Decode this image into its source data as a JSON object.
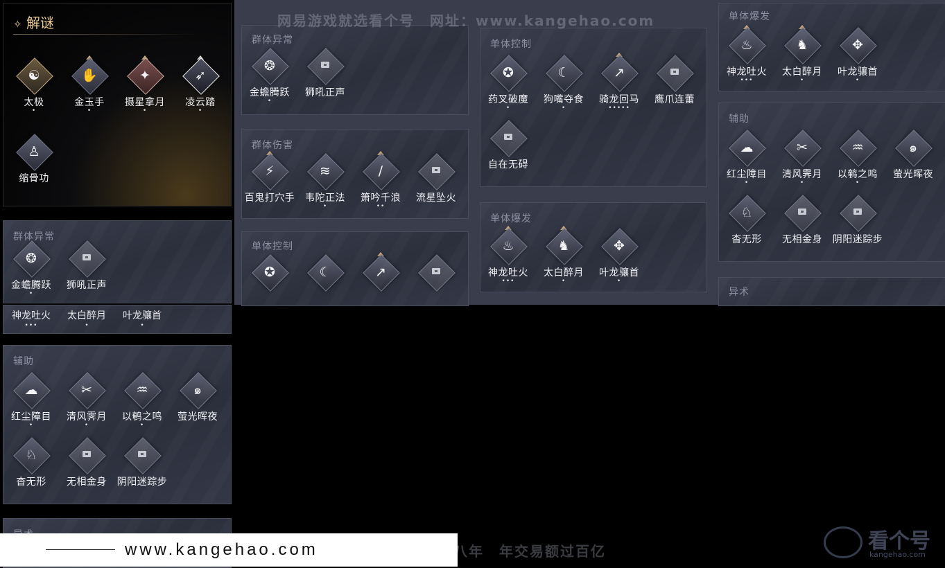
{
  "watermarks": {
    "top": "网易游戏就选看个号　网址：www.kangehao.com",
    "bottom": "看个号专业网易游戏八年　年交易额过百亿",
    "brand": "看个号",
    "brand_url": "kangehao.com",
    "footer_url": "www.kangehao.com"
  },
  "puzzle": {
    "star": "✧",
    "title": "解谜",
    "skills": [
      {
        "name": "太极",
        "dots": "•"
      },
      {
        "name": "金玉手",
        "dots": "•"
      },
      {
        "name": "摄星拿月",
        "dots": "•"
      },
      {
        "name": "凌云踏",
        "dots": "•"
      },
      {
        "name": "缩骨功",
        "dots": ""
      }
    ]
  },
  "left_col": {
    "group_abnormal": {
      "title": "群体异常",
      "skills": [
        {
          "name": "金蟾腾跃",
          "dots": "•"
        },
        {
          "name": "狮吼正声",
          "dots": ""
        }
      ]
    },
    "burst_partial": {
      "skills": [
        {
          "name": "神龙吐火",
          "dots": "•••"
        },
        {
          "name": "太白醉月",
          "dots": "•"
        },
        {
          "name": "叶龙骧首",
          "dots": "•"
        }
      ]
    },
    "support": {
      "title": "辅助",
      "skills": [
        {
          "name": "红尘障目",
          "dots": "•"
        },
        {
          "name": "清风霁月",
          "dots": "•"
        },
        {
          "name": "以鹌之鸣",
          "dots": "•"
        },
        {
          "name": "萤光晖夜",
          "dots": ""
        },
        {
          "name": "杳无形",
          "dots": ""
        },
        {
          "name": "无相金身",
          "dots": ""
        },
        {
          "name": "阴阳迷踪步",
          "dots": ""
        }
      ]
    },
    "bottom_partial_title": "异术"
  },
  "col2": {
    "group_abnormal": {
      "title": "群体异常",
      "skills": [
        {
          "name": "金蟾腾跃",
          "dots": "•"
        },
        {
          "name": "狮吼正声",
          "dots": ""
        }
      ]
    },
    "group_damage": {
      "title": "群体伤害",
      "skills": [
        {
          "name": "百鬼打穴手",
          "dots": ""
        },
        {
          "name": "韦陀正法",
          "dots": "•"
        },
        {
          "name": "箫吟千浪",
          "dots": "••"
        },
        {
          "name": "流星坠火",
          "dots": ""
        }
      ]
    },
    "single_control": {
      "title": "单体控制"
    }
  },
  "col3": {
    "single_control": {
      "title": "单体控制",
      "skills": [
        {
          "name": "药叉破魔",
          "dots": "•"
        },
        {
          "name": "狗嘴夺食",
          "dots": "•"
        },
        {
          "name": "骑龙回马",
          "dots": "•••••"
        },
        {
          "name": "鹰爪连蕾",
          "dots": ""
        },
        {
          "name": "自在无碍",
          "dots": ""
        }
      ]
    },
    "single_burst": {
      "title": "单体爆发",
      "skills": [
        {
          "name": "神龙吐火",
          "dots": "•••"
        },
        {
          "name": "太白醉月",
          "dots": "•"
        },
        {
          "name": "叶龙骧首",
          "dots": "•"
        }
      ]
    }
  },
  "col4": {
    "single_burst": {
      "title": "单体爆发",
      "skills": [
        {
          "name": "神龙吐火",
          "dots": "•••"
        },
        {
          "name": "太白醉月",
          "dots": "•"
        },
        {
          "name": "叶龙骧首",
          "dots": "•"
        }
      ]
    },
    "support": {
      "title": "辅助",
      "skills": [
        {
          "name": "红尘障目",
          "dots": "•"
        },
        {
          "name": "清风霁月",
          "dots": "•"
        },
        {
          "name": "以鹌之鸣",
          "dots": "•"
        },
        {
          "name": "萤光晖夜",
          "dots": ""
        },
        {
          "name": "杳无形",
          "dots": ""
        },
        {
          "name": "无相金身",
          "dots": ""
        },
        {
          "name": "阴阳迷踪步",
          "dots": ""
        }
      ]
    },
    "bottom_title": "异术"
  },
  "colors": {
    "gold": "#e9c98e",
    "panel": "#2f3240",
    "text": "#f0f0f4",
    "muted": "#8c8fa0"
  }
}
